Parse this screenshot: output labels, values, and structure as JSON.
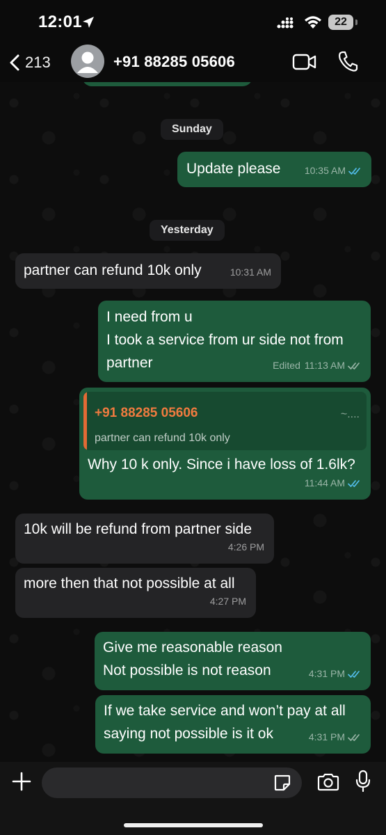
{
  "status_bar": {
    "time": "12:01",
    "battery": "22",
    "icons": [
      "location-arrow-icon",
      "signal-icon",
      "wifi-icon",
      "battery-icon"
    ]
  },
  "header": {
    "back_count": "213",
    "contact": "+91 88285 05606",
    "icons": [
      "chevron-left-icon",
      "avatar-icon",
      "video-call-icon",
      "phone-icon"
    ]
  },
  "chat": {
    "dates": [
      "Sunday",
      "Yesterday"
    ],
    "messages": [
      {
        "dir": "out",
        "text": "Update please",
        "time": "10:35 AM",
        "status": "read"
      },
      {
        "dir": "in",
        "text": "partner can refund 10k only",
        "time": "10:31 AM"
      },
      {
        "dir": "out",
        "text": "I need from u\nI took a service from ur side not from\npartner",
        "time": "11:13 AM",
        "edited": "Edited",
        "status": "delivered"
      },
      {
        "dir": "out",
        "text": "Why 10 k only. Since i have loss of 1.6lk?",
        "time": "11:44 AM",
        "status": "read",
        "quote": {
          "author": "+91 88285 05606",
          "marker": "~....",
          "text": "partner can refund 10k only"
        }
      },
      {
        "dir": "in",
        "text": "10k will be refund from partner side",
        "time": "4:26 PM"
      },
      {
        "dir": "in",
        "text": "more then that not possible at all",
        "time": "4:27 PM"
      },
      {
        "dir": "out",
        "text": "Give me reasonable reason\nNot possible is not reason",
        "time": "4:31 PM",
        "status": "read"
      },
      {
        "dir": "out",
        "text": "If we take service and won’t pay at all\nsaying not possible is it ok",
        "time": "4:31 PM",
        "status": "delivered"
      }
    ]
  },
  "input_bar": {
    "placeholder": "",
    "icons": [
      "plus-icon",
      "sticker-icon",
      "camera-icon",
      "microphone-icon"
    ]
  },
  "colors": {
    "outgoing_bubble": "#1e5b3c",
    "incoming_bubble": "#242426",
    "read_ticks": "#53bdeb",
    "quote_accent": "#e26a35"
  }
}
